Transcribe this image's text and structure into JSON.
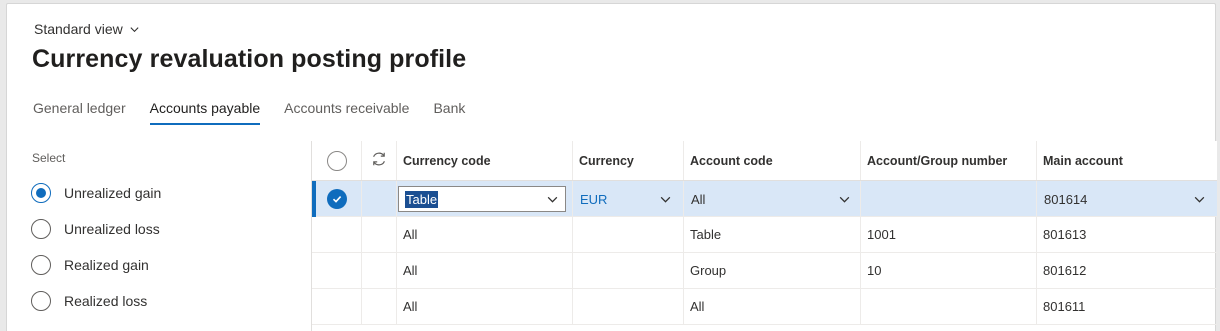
{
  "header": {
    "view_selector": "Standard view",
    "title": "Currency revaluation posting profile"
  },
  "tabs": [
    {
      "label": "General ledger",
      "active": false
    },
    {
      "label": "Accounts payable",
      "active": true
    },
    {
      "label": "Accounts receivable",
      "active": false
    },
    {
      "label": "Bank",
      "active": false
    }
  ],
  "select": {
    "label": "Select",
    "options": [
      {
        "label": "Unrealized gain",
        "selected": true
      },
      {
        "label": "Unrealized loss",
        "selected": false
      },
      {
        "label": "Realized gain",
        "selected": false
      },
      {
        "label": "Realized loss",
        "selected": false
      }
    ]
  },
  "grid": {
    "columns": [
      "Currency code",
      "Currency",
      "Account code",
      "Account/Group number",
      "Main account"
    ],
    "rows": [
      {
        "currency_code": "Table",
        "currency": "EUR",
        "account_code": "All",
        "group_number": "",
        "main_account": "801614",
        "selected": true
      },
      {
        "currency_code": "All",
        "currency": "",
        "account_code": "Table",
        "group_number": "1001",
        "main_account": "801613",
        "selected": false
      },
      {
        "currency_code": "All",
        "currency": "",
        "account_code": "Group",
        "group_number": "10",
        "main_account": "801612",
        "selected": false
      },
      {
        "currency_code": "All",
        "currency": "",
        "account_code": "All",
        "group_number": "",
        "main_account": "801611",
        "selected": false
      }
    ]
  },
  "icons": {
    "view_chevron": "chevron-down-icon",
    "refresh": "refresh-icon",
    "row_check": "checkmark-icon",
    "dropdown": "chevron-down-icon"
  },
  "colors": {
    "accent": "#0f6cbd",
    "selected_row": "#d9e7f7",
    "text_selection": "#1b4f92"
  }
}
